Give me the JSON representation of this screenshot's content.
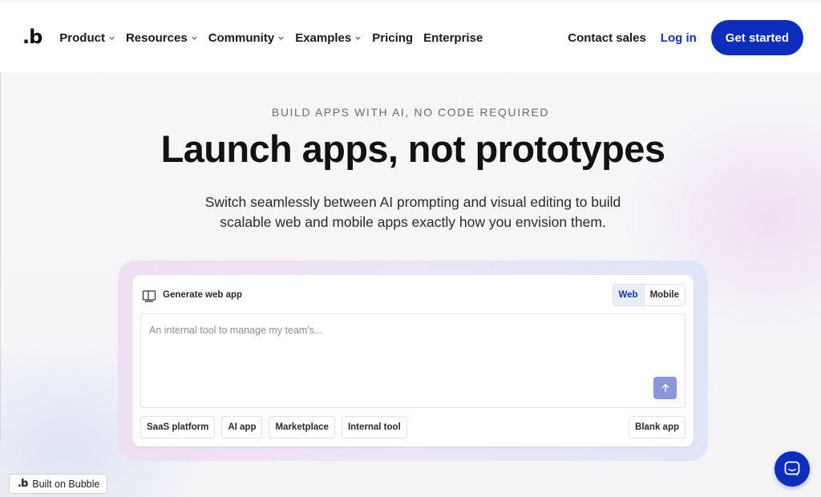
{
  "brand": {
    "logo": ".b"
  },
  "nav": {
    "items": [
      {
        "label": "Product",
        "has_dropdown": true
      },
      {
        "label": "Resources",
        "has_dropdown": true
      },
      {
        "label": "Community",
        "has_dropdown": true
      },
      {
        "label": "Examples",
        "has_dropdown": true
      },
      {
        "label": "Pricing",
        "has_dropdown": false
      },
      {
        "label": "Enterprise",
        "has_dropdown": false
      }
    ],
    "contact_sales": "Contact sales",
    "login": "Log in",
    "get_started": "Get started"
  },
  "hero": {
    "eyebrow": "BUILD APPS WITH AI, NO CODE REQUIRED",
    "headline": "Launch apps, not prototypes",
    "sub_line1": "Switch seamlessly between AI prompting and visual editing to build",
    "sub_line2": "scalable web and mobile apps exactly how you envision them."
  },
  "generator": {
    "label": "Generate web app",
    "toggle": {
      "web": "Web",
      "mobile": "Mobile",
      "selected": "Web"
    },
    "placeholder": "An internal tool to manage my team's...",
    "chips": [
      "SaaS platform",
      "AI app",
      "Marketplace",
      "Internal tool"
    ],
    "blank_app": "Blank app"
  },
  "badge": {
    "mark": ".b",
    "label": "Built on Bubble"
  },
  "colors": {
    "brand_blue": "#0d2dbd",
    "send_button": "#8b97da",
    "web_toggle_bg": "#e8eefc"
  },
  "icons": {
    "generate": "book-open-icon",
    "send": "arrow-up-icon",
    "chat": "chat-bubble-icon",
    "dropdown": "chevron-down-icon"
  }
}
